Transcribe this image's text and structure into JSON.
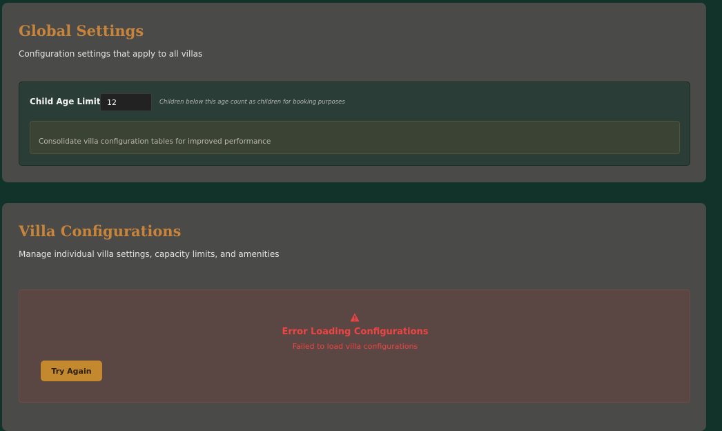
{
  "global_settings": {
    "title": "Global Settings",
    "subtitle": "Configuration settings that apply to all villas",
    "child_age": {
      "label": "Child Age Limit:",
      "value": "12",
      "hint": "Children below this age count as children for booking purposes"
    },
    "info_text": "Consolidate villa configuration tables for improved performance"
  },
  "villa_configurations": {
    "title": "Villa Configurations",
    "subtitle": "Manage individual villa settings, capacity limits, and amenities",
    "error": {
      "icon": "warning-icon",
      "title": "Error Loading Configurations",
      "message": "Failed to load villa configurations",
      "retry_label": "Try Again"
    }
  },
  "colors": {
    "page_background": "#11332a",
    "card_background": "#4a4a48",
    "accent": "#c8843a",
    "error": "#ef4444",
    "button": "#c4882e"
  }
}
